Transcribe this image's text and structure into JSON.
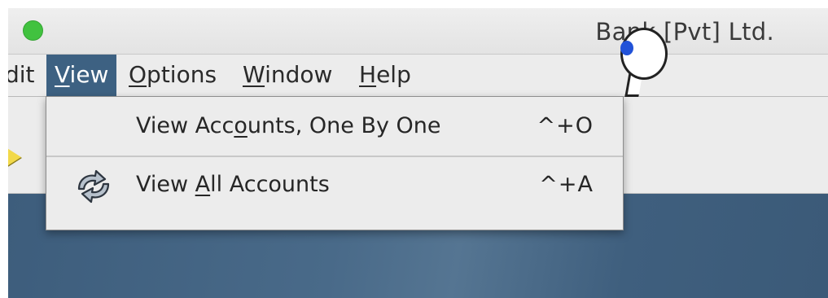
{
  "window": {
    "title": "Bank [Pvt] Ltd."
  },
  "menubar": {
    "items": [
      {
        "pre": "",
        "ul": "",
        "post": "dit"
      },
      {
        "pre": "",
        "ul": "V",
        "post": "iew"
      },
      {
        "pre": "",
        "ul": "O",
        "post": "ptions"
      },
      {
        "pre": "",
        "ul": "W",
        "post": "indow"
      },
      {
        "pre": "",
        "ul": "H",
        "post": "elp"
      }
    ],
    "active": "View"
  },
  "dropdown": {
    "items": [
      {
        "pre": "View Acc",
        "ul": "o",
        "post": "unts, One By One",
        "shortcut": "^+O",
        "icon": ""
      },
      {
        "pre": "View ",
        "ul": "A",
        "post": "ll Accounts",
        "shortcut": "^+A",
        "icon": "refresh-icon"
      }
    ]
  },
  "colors": {
    "active_menu": "#3d6182",
    "traffic_green": "#41c23f",
    "desktop": "#3f5f7d"
  }
}
